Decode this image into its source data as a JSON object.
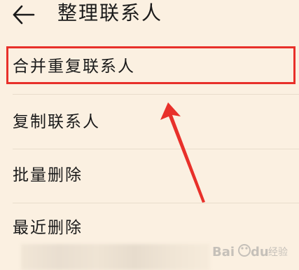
{
  "header": {
    "title": "整理联系人",
    "back_icon": "arrow-left-icon"
  },
  "menu": {
    "items": [
      {
        "label": "合并重复联系人",
        "highlighted": true
      },
      {
        "label": "复制联系人"
      },
      {
        "label": "批量删除"
      },
      {
        "label": "最近删除"
      }
    ]
  },
  "annotation": {
    "color": "#e8302a",
    "arrow_icon": "red-arrow-icon"
  },
  "watermark": {
    "text": "Baidu 经验"
  }
}
